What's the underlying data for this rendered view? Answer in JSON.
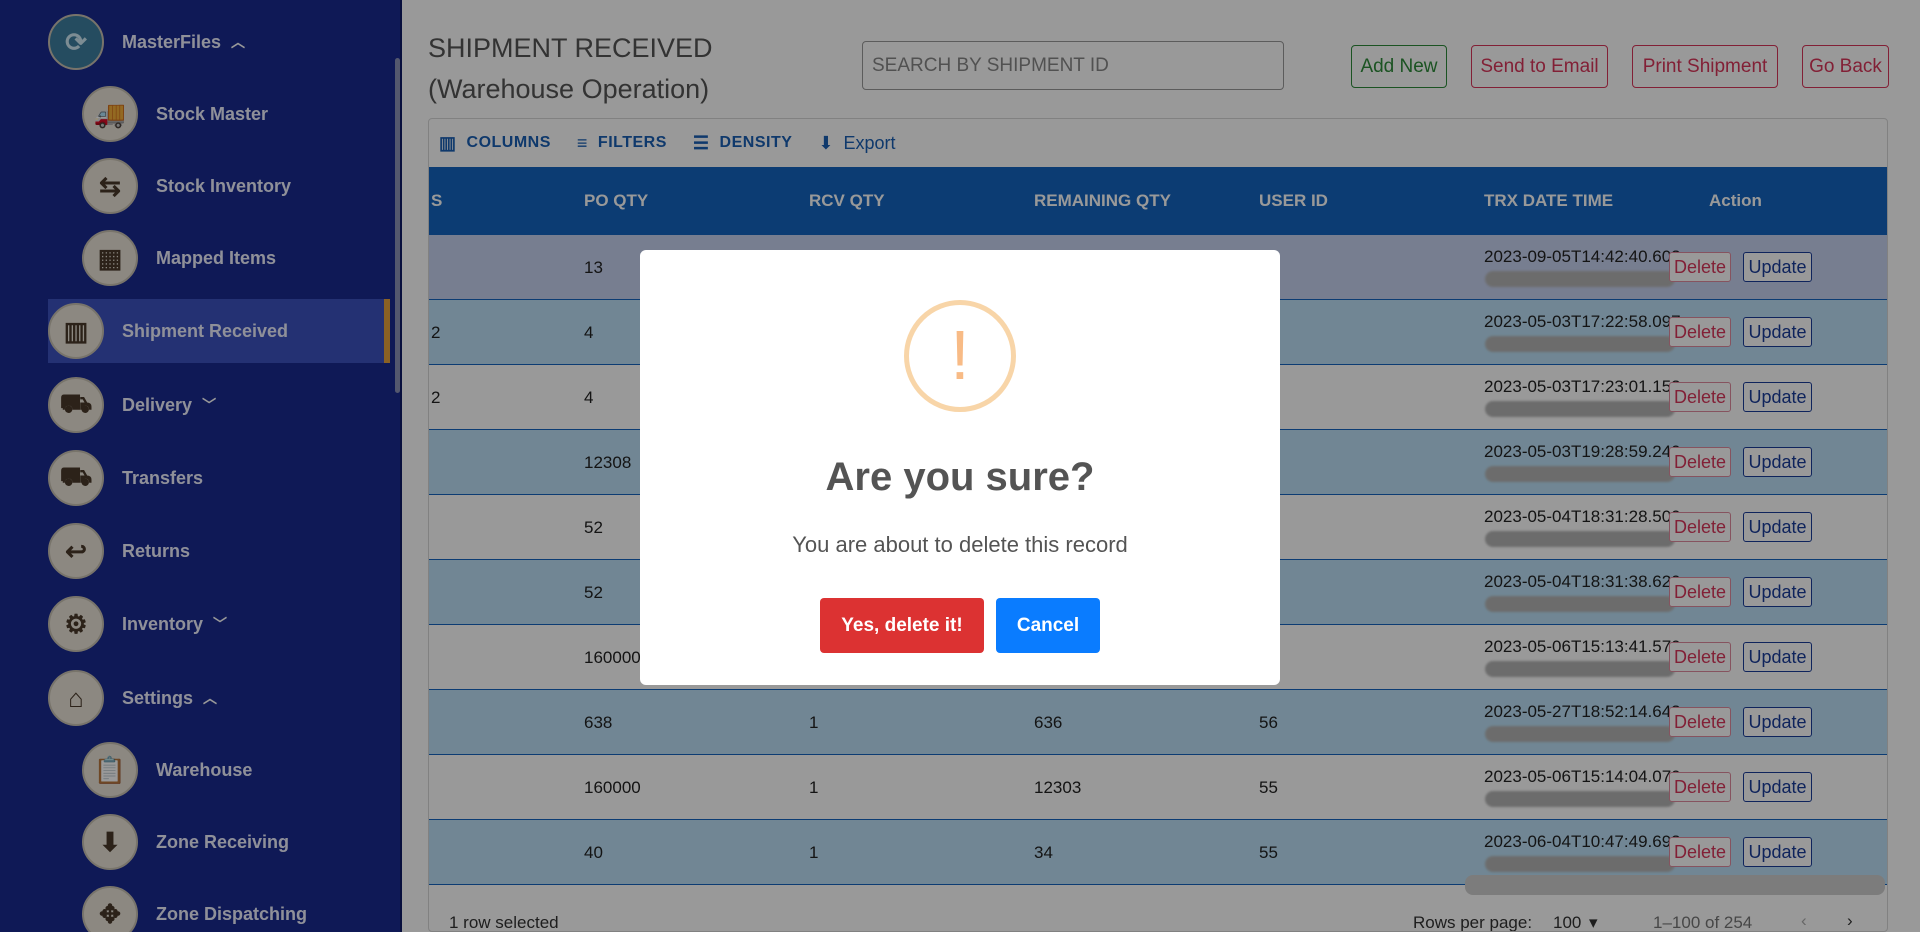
{
  "sidebar": {
    "items": [
      {
        "label": "MasterFiles",
        "chevron": "^",
        "icon": "refresh-files-icon"
      },
      {
        "label": "Stock Master",
        "icon": "truck-boxes-icon"
      },
      {
        "label": "Stock Inventory",
        "icon": "box-arrows-icon"
      },
      {
        "label": "Mapped Items",
        "icon": "mapped-boxes-icon"
      },
      {
        "label": "Shipment Received",
        "icon": "shipment-icon"
      },
      {
        "label": "Delivery",
        "chevron": "⌄",
        "icon": "forklift-icon"
      },
      {
        "label": "Transfers",
        "icon": "transfer-truck-icon"
      },
      {
        "label": "Returns",
        "icon": "returns-icon"
      },
      {
        "label": "Inventory",
        "chevron": "⌄",
        "icon": "inventory-gear-icon"
      },
      {
        "label": "Settings",
        "chevron": "^",
        "icon": "warehouse-gear-icon"
      },
      {
        "label": "Warehouse",
        "icon": "clipboard-icon"
      },
      {
        "label": "Zone Receiving",
        "icon": "zone-receiving-icon"
      },
      {
        "label": "Zone Dispatching",
        "icon": "zone-dispatch-icon"
      }
    ]
  },
  "header": {
    "title": "SHIPMENT RECEIVED (Warehouse Operation)",
    "search_placeholder": "SEARCH BY SHIPMENT ID",
    "buttons": {
      "add_new": "Add New",
      "send_email": "Send to Email",
      "print": "Print Shipment",
      "go_back": "Go Back"
    }
  },
  "toolbar": {
    "columns": "COLUMNS",
    "filters": "FILTERS",
    "density": "DENSITY",
    "export": "Export"
  },
  "table": {
    "columns": [
      "S",
      "PO QTY",
      "RCV QTY",
      "REMAINING QTY",
      "USER ID",
      "TRX DATE TIME",
      "Action"
    ],
    "delete_label": "Delete",
    "update_label": "Update",
    "rows": [
      {
        "s": "",
        "po": "13",
        "rcv": "",
        "rem": "",
        "user": "",
        "dt": "2023-09-05T14:42:40.603"
      },
      {
        "s": "2",
        "po": "4",
        "rcv": "",
        "rem": "",
        "user": "",
        "dt": "2023-05-03T17:22:58.097"
      },
      {
        "s": "2",
        "po": "4",
        "rcv": "",
        "rem": "",
        "user": "",
        "dt": "2023-05-03T17:23:01.153"
      },
      {
        "s": "",
        "po": "12308",
        "rcv": "",
        "rem": "",
        "user": "",
        "dt": "2023-05-03T19:28:59.240"
      },
      {
        "s": "",
        "po": "52",
        "rcv": "",
        "rem": "",
        "user": "",
        "dt": "2023-05-04T18:31:28.500"
      },
      {
        "s": "",
        "po": "52",
        "rcv": "",
        "rem": "",
        "user": "",
        "dt": "2023-05-04T18:31:38.620"
      },
      {
        "s": "",
        "po": "160000",
        "rcv": "",
        "rem": "",
        "user": "",
        "dt": "2023-05-06T15:13:41.570"
      },
      {
        "s": "",
        "po": "638",
        "rcv": "1",
        "rem": "636",
        "user": "56",
        "dt": "2023-05-27T18:52:14.643"
      },
      {
        "s": "",
        "po": "160000",
        "rcv": "1",
        "rem": "12303",
        "user": "55",
        "dt": "2023-05-06T15:14:04.070"
      },
      {
        "s": "",
        "po": "40",
        "rcv": "1",
        "rem": "34",
        "user": "55",
        "dt": "2023-06-04T10:47:49.693"
      }
    ]
  },
  "footer": {
    "selected": "1 row selected",
    "rows_per_page_label": "Rows per page:",
    "rows_per_page": "100",
    "range": "1–100 of 254"
  },
  "modal": {
    "icon": "!",
    "title": "Are you sure?",
    "text": "You are about to delete this record",
    "confirm": "Yes, delete it!",
    "cancel": "Cancel"
  }
}
